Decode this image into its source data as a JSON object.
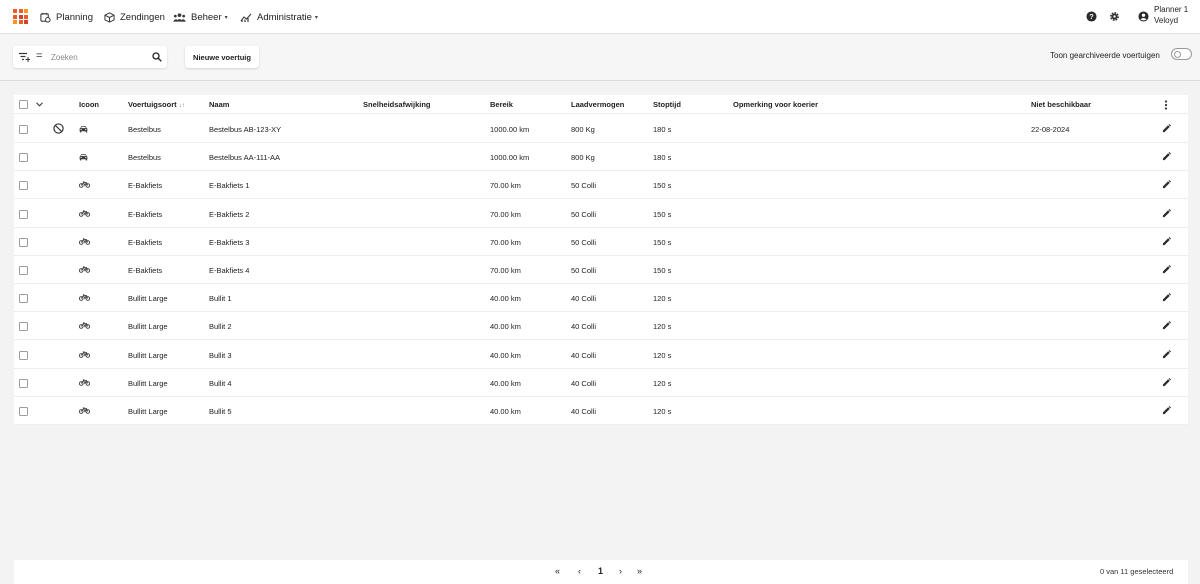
{
  "nav": {
    "items": [
      {
        "label": "Planning",
        "icon": "planning-icon"
      },
      {
        "label": "Zendingen",
        "icon": "package-icon"
      },
      {
        "label": "Beheer",
        "icon": "people-icon",
        "dropdown": true
      },
      {
        "label": "Administratie",
        "icon": "analytics-icon",
        "dropdown": true
      }
    ],
    "help_icon": "help-icon",
    "settings_icon": "gear-icon",
    "user": {
      "line1": "Planner 1",
      "line2": "Veloyd",
      "icon": "account-icon"
    }
  },
  "toolbar": {
    "search_placeholder": "Zoeken",
    "search_value": "",
    "new_vehicle_label": "Nieuwe voertuig",
    "archive_toggle_label": "Toon gearchiveerde voertuigen",
    "archive_toggle_on": false
  },
  "table": {
    "columns": {
      "icon": "Icoon",
      "type": "Voertuigsoort",
      "name": "Naam",
      "speed": "Snelheidsafwijking",
      "range": "Bereik",
      "capacity": "Laadvermogen",
      "stoptime": "Stoptijd",
      "remark": "Opmerking voor koerier",
      "unavailable": "Niet beschikbaar"
    },
    "rows": [
      {
        "blocked": true,
        "icon": "car-icon",
        "type": "Bestelbus",
        "name": "Bestelbus AB-123-XY",
        "speed": "",
        "range": "1000.00 km",
        "capacity": "800 Kg",
        "stoptime": "180 s",
        "remark": "",
        "unavailable": "22-08-2024"
      },
      {
        "blocked": false,
        "icon": "car-icon",
        "type": "Bestelbus",
        "name": "Bestelbus AA-111-AA",
        "speed": "",
        "range": "1000.00 km",
        "capacity": "800 Kg",
        "stoptime": "180 s",
        "remark": "",
        "unavailable": ""
      },
      {
        "blocked": false,
        "icon": "bike-icon",
        "type": "E-Bakfiets",
        "name": "E-Bakfiets 1",
        "speed": "",
        "range": "70.00 km",
        "capacity": "50 Colli",
        "stoptime": "150 s",
        "remark": "",
        "unavailable": ""
      },
      {
        "blocked": false,
        "icon": "bike-icon",
        "type": "E-Bakfiets",
        "name": "E-Bakfiets 2",
        "speed": "",
        "range": "70.00 km",
        "capacity": "50 Colli",
        "stoptime": "150 s",
        "remark": "",
        "unavailable": ""
      },
      {
        "blocked": false,
        "icon": "bike-icon",
        "type": "E-Bakfiets",
        "name": "E-Bakfiets 3",
        "speed": "",
        "range": "70.00 km",
        "capacity": "50 Colli",
        "stoptime": "150 s",
        "remark": "",
        "unavailable": ""
      },
      {
        "blocked": false,
        "icon": "bike-icon",
        "type": "E-Bakfiets",
        "name": "E-Bakfiets 4",
        "speed": "",
        "range": "70.00 km",
        "capacity": "50 Colli",
        "stoptime": "150 s",
        "remark": "",
        "unavailable": ""
      },
      {
        "blocked": false,
        "icon": "bike-icon",
        "type": "Bullitt Large",
        "name": "Bullit 1",
        "speed": "",
        "range": "40.00 km",
        "capacity": "40 Colli",
        "stoptime": "120 s",
        "remark": "",
        "unavailable": ""
      },
      {
        "blocked": false,
        "icon": "bike-icon",
        "type": "Bullitt Large",
        "name": "Bullit 2",
        "speed": "",
        "range": "40.00 km",
        "capacity": "40 Colli",
        "stoptime": "120 s",
        "remark": "",
        "unavailable": ""
      },
      {
        "blocked": false,
        "icon": "bike-icon",
        "type": "Bullitt Large",
        "name": "Bullit 3",
        "speed": "",
        "range": "40.00 km",
        "capacity": "40 Colli",
        "stoptime": "120 s",
        "remark": "",
        "unavailable": ""
      },
      {
        "blocked": false,
        "icon": "bike-icon",
        "type": "Bullitt Large",
        "name": "Bullit 4",
        "speed": "",
        "range": "40.00 km",
        "capacity": "40 Colli",
        "stoptime": "120 s",
        "remark": "",
        "unavailable": ""
      },
      {
        "blocked": false,
        "icon": "bike-icon",
        "type": "Bullitt Large",
        "name": "Bullit 5",
        "speed": "",
        "range": "40.00 km",
        "capacity": "40 Colli",
        "stoptime": "120 s",
        "remark": "",
        "unavailable": ""
      }
    ]
  },
  "pagination": {
    "first": "«",
    "prev": "‹",
    "current": "1",
    "next": "›",
    "last": "»",
    "selection_status": "0 van 11 geselecteerd"
  },
  "colors": {
    "logo_orange": "#f15a24",
    "logo_dark": "#d4412a",
    "icon_gray": "#3a3a3a"
  }
}
